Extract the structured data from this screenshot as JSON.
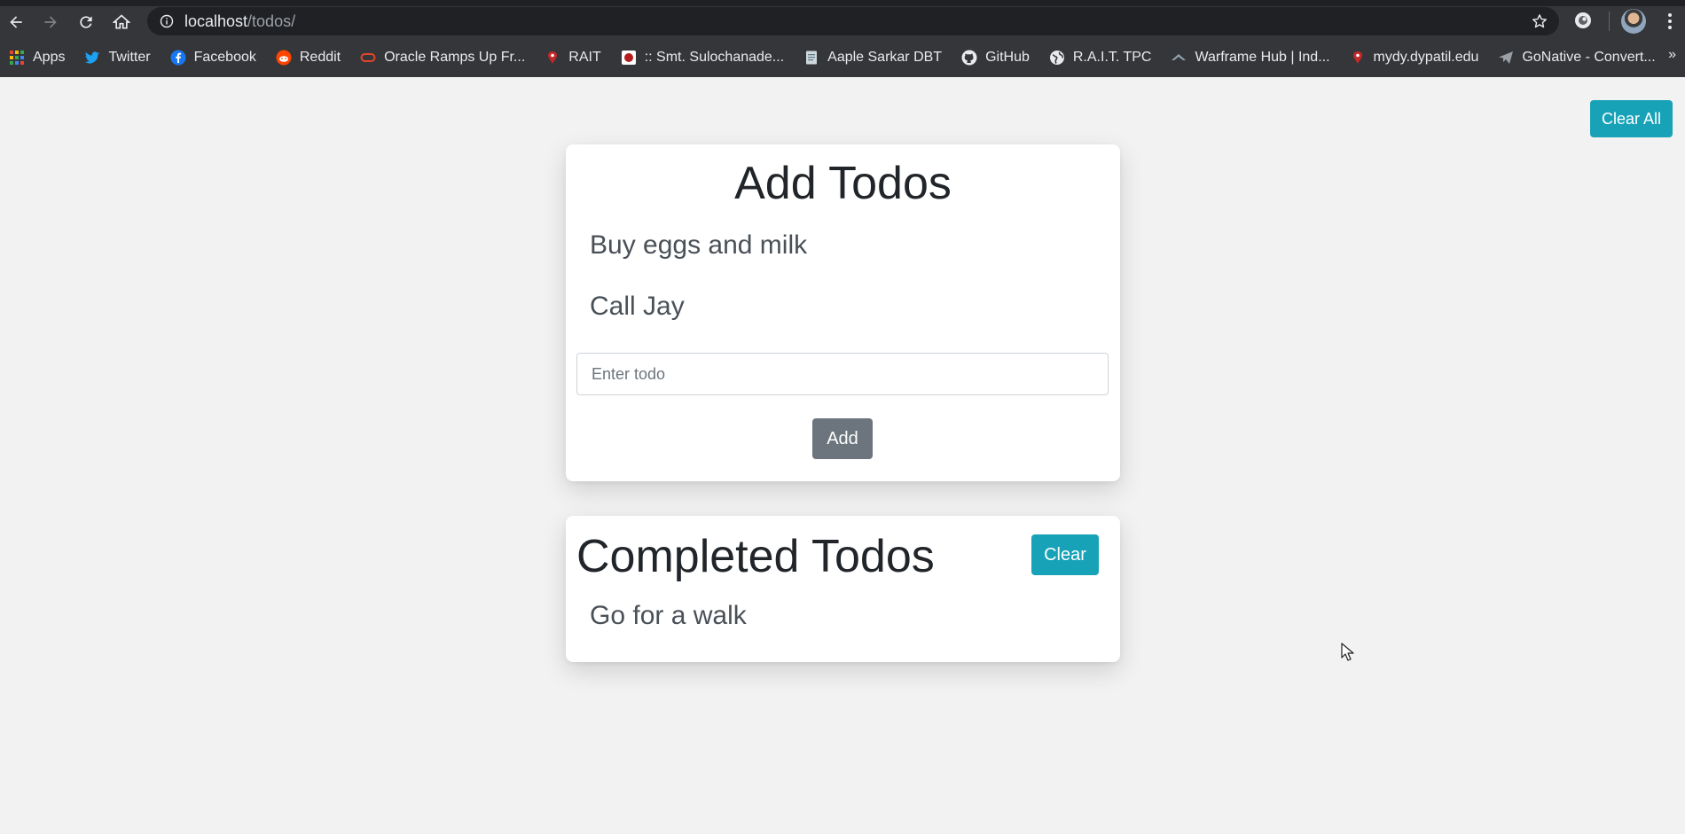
{
  "browser": {
    "url_host": "localhost",
    "url_path": "/todos/",
    "bookmarks": [
      {
        "label": "Apps",
        "icon": "apps-grid-icon",
        "color": "#e57373"
      },
      {
        "label": "Twitter",
        "icon": "twitter-icon",
        "color": "#1da1f2"
      },
      {
        "label": "Facebook",
        "icon": "facebook-icon",
        "color": "#1877f2"
      },
      {
        "label": "Reddit",
        "icon": "reddit-icon",
        "color": "#ff4500"
      },
      {
        "label": "Oracle Ramps Up Fr...",
        "icon": "oracle-icon",
        "color": "#e2452a"
      },
      {
        "label": "RAIT",
        "icon": "rait-icon",
        "color": "#c62828"
      },
      {
        "label": ":: Smt. Sulochanade...",
        "icon": "college-seal-icon",
        "color": "#b71c1c"
      },
      {
        "label": "Aaple Sarkar DBT",
        "icon": "document-icon",
        "color": "#cfd8dc"
      },
      {
        "label": "GitHub",
        "icon": "github-icon",
        "color": "#e8eaed"
      },
      {
        "label": "R.A.I.T. TPC",
        "icon": "globe-icon",
        "color": "#e8eaed"
      },
      {
        "label": "Warframe Hub | Ind...",
        "icon": "warframe-icon",
        "color": "#90a4ae"
      },
      {
        "label": "mydy.dypatil.edu",
        "icon": "dypatil-icon",
        "color": "#c62828"
      },
      {
        "label": "GoNative - Convert...",
        "icon": "paper-plane-icon",
        "color": "#9aa0a6"
      }
    ],
    "more_label": "»"
  },
  "header": {
    "clear_all_label": "Clear All"
  },
  "add_card": {
    "title": "Add Todos",
    "todos": [
      "Buy eggs and milk",
      "Call Jay"
    ],
    "input_placeholder": "Enter todo",
    "input_value": "",
    "add_label": "Add"
  },
  "completed_card": {
    "title": "Completed Todos",
    "clear_label": "Clear",
    "todos": [
      "Go for a walk"
    ]
  },
  "colors": {
    "accent": "#17a2b8",
    "secondary": "#6c757d",
    "page_bg": "#f2f2f2",
    "chrome_bg": "#35363a"
  }
}
